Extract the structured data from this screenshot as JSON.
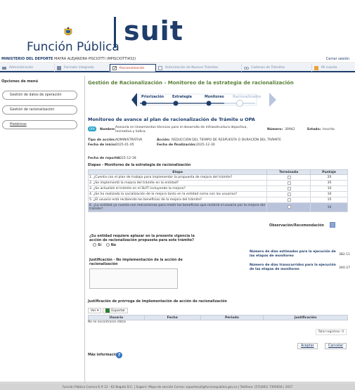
{
  "header": {
    "logo_text": "Función Pública",
    "brand": "suit"
  },
  "userbar": {
    "entity": "MINISTERIO DEL DEPORTE",
    "user": "MAYRA ALEJANDRA PISCIOTTI (MPISCIOTTI432)",
    "logout": "Cerrar sesión"
  },
  "tabs": [
    {
      "label": "Administración",
      "icon": "tools-icon"
    },
    {
      "label": "Formato integrado",
      "icon": "grid-icon"
    },
    {
      "label": "Racionalización",
      "icon": "edit-icon"
    },
    {
      "label": "Autorización de Nuevos Trámites",
      "icon": "doc-icon"
    },
    {
      "label": "Cadenas de Trámites",
      "icon": "chain-icon"
    },
    {
      "label": "Mi cuenta",
      "icon": "user-icon"
    }
  ],
  "sidebar": {
    "title": "Opciones de menú",
    "items": [
      "Gestión de datos de operación",
      "Gestión de racionalización",
      "Históricos"
    ]
  },
  "main": {
    "title": "Gestión de Racionalización - Monitoreo de la estrategia de racionalización",
    "steps": [
      "Priorización",
      "Estrategia",
      "Monitoreo",
      "Racionalizados"
    ],
    "subtitle": "Monitoreo de avance al plan de racionalización de Trámite u OPA",
    "state_tag": "OPA",
    "nombre_label": "Nombre:",
    "nombre_value": "Asesoría en lineamientos técnicos para el desarrollo de infraestructura deportiva, recreativa y lúdica.",
    "numero_label": "Número:",
    "numero_value": "30942",
    "estado_label": "Estado:",
    "estado_value": "Inscrito",
    "tipo_label": "Tipo de acción:",
    "tipo_value": "ADMINISTRATIVA",
    "accion_label": "Acción:",
    "accion_value": "REDUCCIÓN DEL TIEMPO DE RESPUESTA O DURACIÓN DEL TRÁMITE",
    "inicio_label": "Fecha de inicio:",
    "inicio_value": "2025-01-05",
    "fin_label": "Fecha de finalización:",
    "fin_value": "2025-12-30",
    "reporte_label": "Fecha de reporte:",
    "reporte_value": "2025-12-18",
    "etapas_title": "Etapas - Monitoreo de la estrategia de racionalización",
    "etapas_headers": [
      "Etapa",
      "Terminada",
      "Puntaje"
    ],
    "etapas": [
      {
        "etapa": "1. ¿Cuenta con el plan de trabajo para implementar la propuesta de mejora del trámite?",
        "puntaje": "20"
      },
      {
        "etapa": "2. ¿Se implementó la mejora del trámite en la entidad?",
        "puntaje": "35"
      },
      {
        "etapa": "3. ¿Se actualizó el trámite en el SUIT incluyendo la mejora?",
        "puntaje": "10"
      },
      {
        "etapa": "4. ¿Se ha realizado la socialización de la mejora tanto en la entidad como con los usuarios?",
        "puntaje": "10"
      },
      {
        "etapa": "5. ¿El usuario está recibiendo los beneficios de la mejora del trámite?",
        "puntaje": "15"
      },
      {
        "etapa": "6. ¿La entidad ya cuenta con mecanismos para medir los beneficios que recibirá el usuario por la mejora del trámite?",
        "puntaje": "10"
      }
    ],
    "obs_label": "Observación/Recomendación",
    "question": "¿Su entidad requiere aplazar en la presente vigencia la acción de racionalización propuesta para este trámite?",
    "si_label": "Sí",
    "no_label": "No",
    "just_label": "Justificación - No implementación de la acción de racionalización",
    "dias_est_label": "Número de días estimados para la ejecución de las etapas de monitoreo",
    "dias_est_value": "382.11",
    "dias_trans_label": "Número de días transcurridos para la ejecución de las etapas de monitoreo",
    "dias_trans_value": "340.27",
    "justif_title": "Justificación de prórroga de implementación de acción de racionalización",
    "ver_label": "Ver ▾",
    "exportar_label": "Exportar",
    "hist_headers": [
      "Usuario",
      "Fecha",
      "Periodo",
      "Justificación"
    ],
    "empty_text": "No se encontraron datos",
    "total_text": "Total registros: 0",
    "aceptar": "Aceptar",
    "cancelar": "Cancelar",
    "more_info": "Más información"
  },
  "footer": {
    "text": "Función Pública Carrera 6 # 12 - 62 Bogotá D.C. | Sugerir: Mapa de sección  Correo: soportesuit@funcionpublica.gov.co | Teléfono: (57)(601) 7395656 | 2017"
  }
}
